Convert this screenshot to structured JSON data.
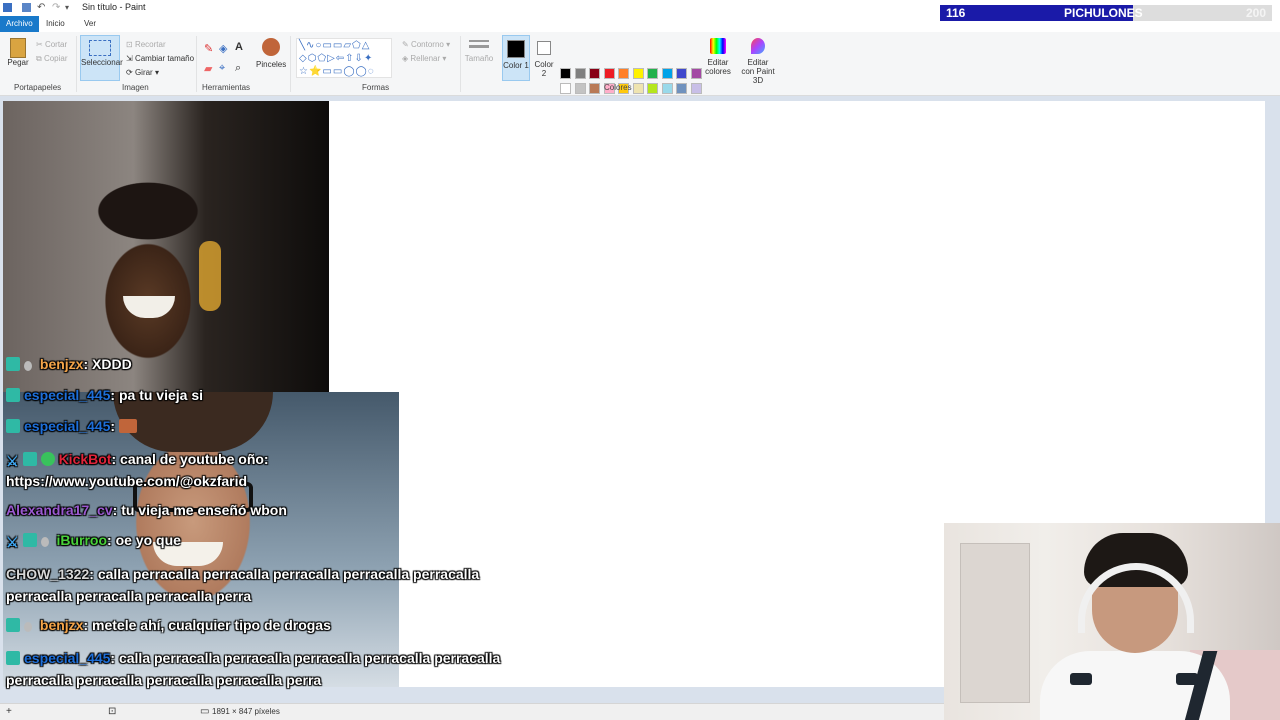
{
  "window": {
    "title": "Sin título - Paint"
  },
  "counter": {
    "value": "116",
    "title": "PICHULONES",
    "goal": "200",
    "progress": 0.58
  },
  "tabs": [
    {
      "label": "Archivo"
    },
    {
      "label": "Inicio"
    },
    {
      "label": "Ver"
    }
  ],
  "ribbon": {
    "clipboard": {
      "paste": "Pegar",
      "cut": "Cortar",
      "copy": "Copiar",
      "group": "Portapapeles"
    },
    "image": {
      "select": "Seleccionar",
      "crop": "Recortar",
      "resize": "Cambiar tamaño",
      "rotate": "Girar",
      "group": "Imagen"
    },
    "tools": {
      "brushes": "Pinceles",
      "group": "Herramientas"
    },
    "shapes": {
      "outline": "Contorno",
      "fill": "Rellenar",
      "group": "Formas"
    },
    "size": {
      "label": "Tamaño"
    },
    "colors": {
      "color1": "Color 1",
      "color2": "Color 2",
      "edit": "Editar colores",
      "paint3d": "Editar con Paint 3D",
      "group": "Colores",
      "palette_row1": [
        "#000000",
        "#7f7f7f",
        "#880015",
        "#ed1c24",
        "#ff7f27",
        "#fff200",
        "#22b14c",
        "#00a2e8",
        "#3f48cc",
        "#a349a4"
      ],
      "palette_row2": [
        "#ffffff",
        "#c3c3c3",
        "#b97a57",
        "#ffaec9",
        "#ffc90e",
        "#efe4b0",
        "#b5e61d",
        "#99d9ea",
        "#7092be",
        "#c8bfe7"
      ]
    }
  },
  "chat": [
    {
      "user": "benjzx",
      "user_color": "#f5a54a",
      "text": "XDDD"
    },
    {
      "user": "especial_445",
      "user_color": "#1e6fd9",
      "text": "pa tu vieja si"
    },
    {
      "user": "especial_445",
      "user_color": "#1e6fd9",
      "text": ""
    },
    {
      "user": "KickBot",
      "user_color": "#e0243a",
      "text": "canal de youtube oño: https://www.youtube.com/@okzfarid"
    },
    {
      "user": "Alexandra17_cv",
      "user_color": "#9b59d0",
      "text": "tu vieja me enseñó wbon"
    },
    {
      "user": "iBurroo",
      "user_color": "#49d13a",
      "text": "oe yo que"
    },
    {
      "user": "CHOW_1322",
      "user_color": "#d8d8d8",
      "text": "calla perracalla perracalla perracalla perracalla perracalla perracalla perracalla perracalla perra"
    },
    {
      "user": "benjzx",
      "user_color": "#f5a54a",
      "text": "metele ahí, cualquier tipo de drogas"
    },
    {
      "user": "especial_445",
      "user_color": "#1e6fd9",
      "text": "calla perracalla perracalla perracalla perracalla perracalla perracalla perracalla perracalla perracalla perra"
    }
  ],
  "status": {
    "size": "1891 × 847 píxeles"
  }
}
